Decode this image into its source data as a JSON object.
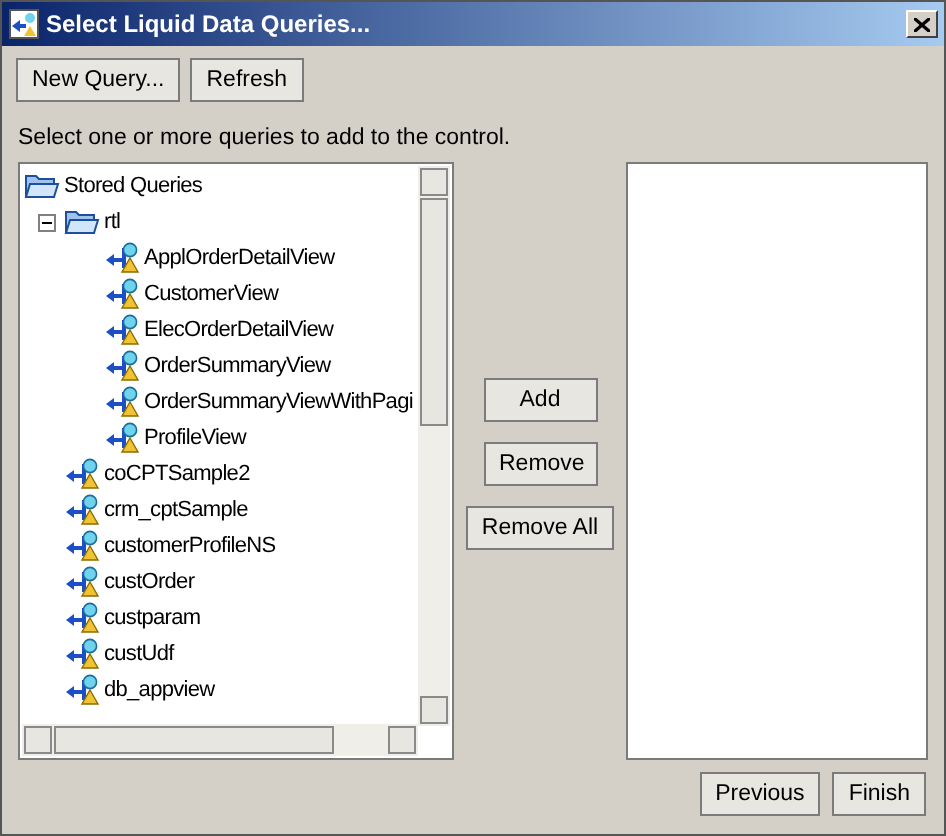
{
  "window": {
    "title": "Select Liquid Data Queries..."
  },
  "toolbar": [
    "New Query...",
    "Refresh"
  ],
  "instruction": "Select one or more queries to add to the control.",
  "tree": {
    "label": "Stored Queries",
    "kind": "folder",
    "expanded": true,
    "children": [
      {
        "label": "rtl",
        "kind": "folder",
        "expanded": true,
        "children": [
          {
            "label": "ApplOrderDetailView",
            "kind": "query"
          },
          {
            "label": "CustomerView",
            "kind": "query"
          },
          {
            "label": "ElecOrderDetailView",
            "kind": "query"
          },
          {
            "label": "OrderSummaryView",
            "kind": "query"
          },
          {
            "label": "OrderSummaryViewWithPagi",
            "kind": "query"
          },
          {
            "label": "ProfileView",
            "kind": "query"
          }
        ]
      },
      {
        "label": "coCPTSample2",
        "kind": "query"
      },
      {
        "label": "crm_cptSample",
        "kind": "query"
      },
      {
        "label": "customerProfileNS",
        "kind": "query"
      },
      {
        "label": "custOrder",
        "kind": "query"
      },
      {
        "label": "custparam",
        "kind": "query"
      },
      {
        "label": "custUdf",
        "kind": "query"
      },
      {
        "label": "db_appview",
        "kind": "query"
      }
    ]
  },
  "middle_buttons": [
    "Add",
    "Remove",
    "Remove All"
  ],
  "footer_buttons": [
    "Previous",
    "Finish"
  ]
}
